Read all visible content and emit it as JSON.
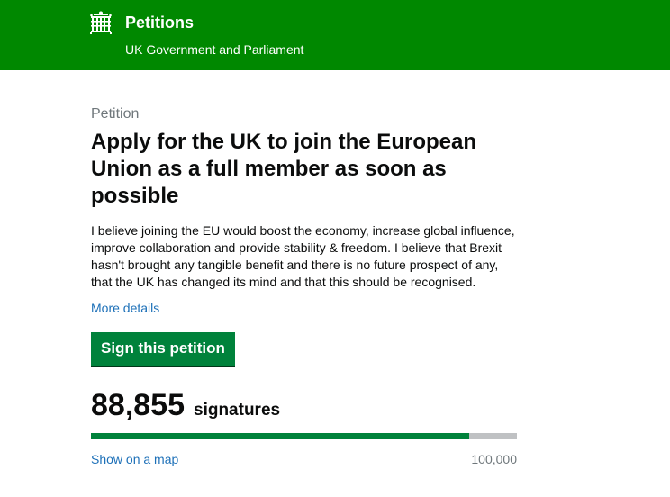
{
  "header": {
    "logo_icon": "portcullis-icon",
    "title": "Petitions",
    "subtitle": "UK Government and Parliament",
    "background_color": "#008800"
  },
  "petition": {
    "kicker": "Petition",
    "title": "Apply for the UK to join the European Union as a full member as soon as possible",
    "description": "I believe joining the EU would boost the economy, increase global influence, improve collaboration and provide stability & freedom. I believe that Brexit hasn't brought any tangible benefit and there is no future prospect of any, that the UK has changed its mind and that this should be recognised.",
    "more_details_label": "More details",
    "sign_button_label": "Sign this petition",
    "sign_button_color": "#00823b"
  },
  "signatures": {
    "count_label": "88,855",
    "unit_label": "signatures",
    "count": 88855,
    "threshold": 100000,
    "threshold_label": "100,000",
    "map_link_label": "Show on a map",
    "progress_color": "#00823b"
  }
}
